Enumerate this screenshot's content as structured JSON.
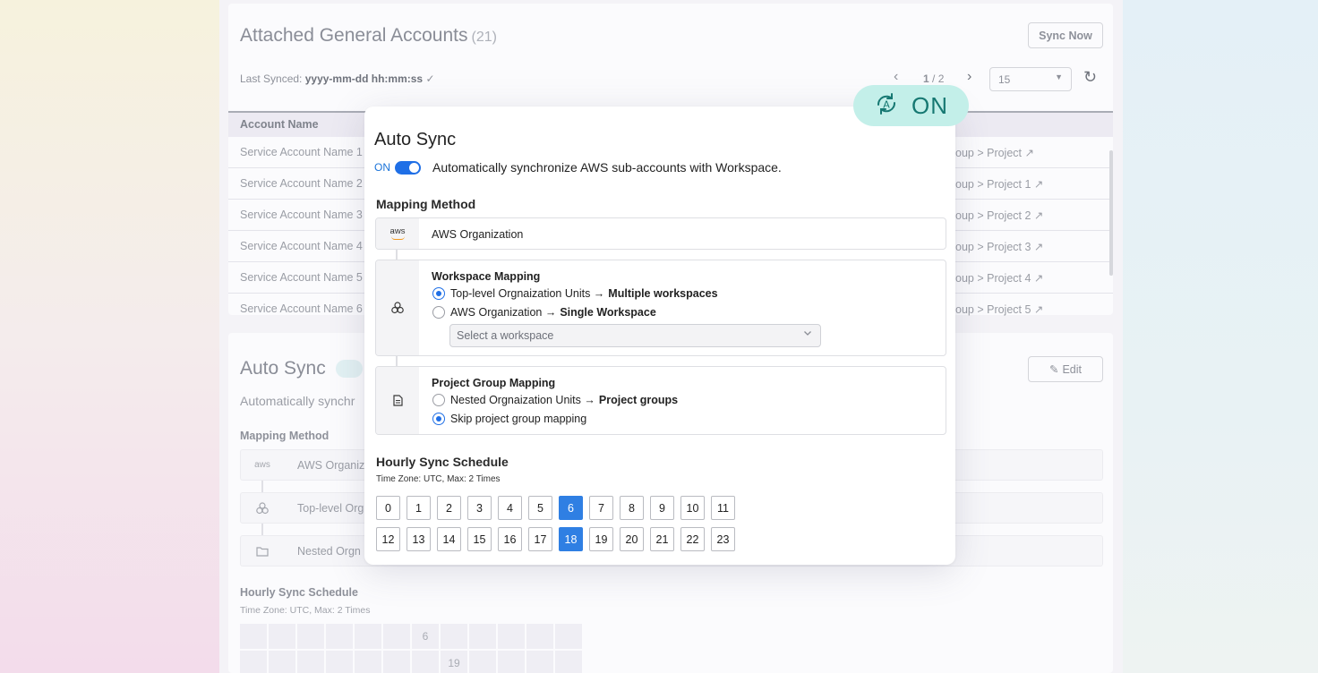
{
  "background": {
    "title": "Attached General Accounts",
    "count": "(21)",
    "sync_now_label": "Sync Now",
    "last_synced_label": "Last Synced:",
    "last_synced_value": "yyyy-mm-dd hh:mm:ss",
    "check_glyph": "✓",
    "pager": {
      "prev": "‹",
      "current": "1",
      "separator": " / ",
      "total": "2",
      "next": "›"
    },
    "page_size": "15",
    "refresh_glyph": "↻",
    "table": {
      "column_header": "Account Name",
      "rows": [
        {
          "name": "Service Account Name 1",
          "target": "oup > Project ↗"
        },
        {
          "name": "Service Account Name 2",
          "target": "oup > Project 1 ↗"
        },
        {
          "name": "Service Account Name 3",
          "target": "oup > Project 2 ↗"
        },
        {
          "name": "Service Account Name 4",
          "target": "oup > Project 3 ↗"
        },
        {
          "name": "Service Account Name 5",
          "target": "oup > Project 4 ↗"
        },
        {
          "name": "Service Account Name 6",
          "target": "oup > Project 5 ↗"
        }
      ]
    },
    "auto_sync_title": "Auto Sync",
    "auto_sync_desc": "Automatically synchr",
    "edit_label": "Edit",
    "mapping_method_label": "Mapping Method",
    "mappings": [
      "AWS Organiz",
      "Top-level Org",
      "Nested Orgn"
    ],
    "hourly_label": "Hourly Sync Schedule",
    "timezone_text": "Time Zone: UTC, Max: 2 Times",
    "grid_row1_marker": "6",
    "grid_row2_marker": "19"
  },
  "badge": {
    "label": "ON",
    "icon": "auto-sync-icon",
    "color": "#c3efe9"
  },
  "modal": {
    "title": "Auto Sync",
    "toggle_state": "ON",
    "toggle_desc": "Automatically synchronize AWS sub-accounts with Workspace.",
    "mapping_method_label": "Mapping Method",
    "aws_logo_text": "aws",
    "aws_org_label": "AWS Organization",
    "workspace_mapping": {
      "title": "Workspace Mapping",
      "option1_pre": "Top-level Orgnaization Units →",
      "option1_bold": "Multiple workspaces",
      "option2_pre": "AWS Organization →",
      "option2_bold": "Single Workspace",
      "select_placeholder": "Select a workspace"
    },
    "project_group_mapping": {
      "title": "Project Group Mapping",
      "option1_pre": "Nested Orgnaization Units →",
      "option1_bold": "Project groups",
      "option2": "Skip project group mapping"
    },
    "hourly": {
      "title": "Hourly Sync Schedule",
      "timezone": "Time Zone: UTC, Max: 2 Times",
      "row1": [
        "0",
        "1",
        "2",
        "3",
        "4",
        "5",
        "6",
        "7",
        "8",
        "9",
        "10",
        "11"
      ],
      "row2": [
        "12",
        "13",
        "14",
        "15",
        "16",
        "17",
        "18",
        "19",
        "20",
        "21",
        "22",
        "23"
      ],
      "selected": [
        "6",
        "18"
      ],
      "accent": "#2f7fe3"
    }
  }
}
